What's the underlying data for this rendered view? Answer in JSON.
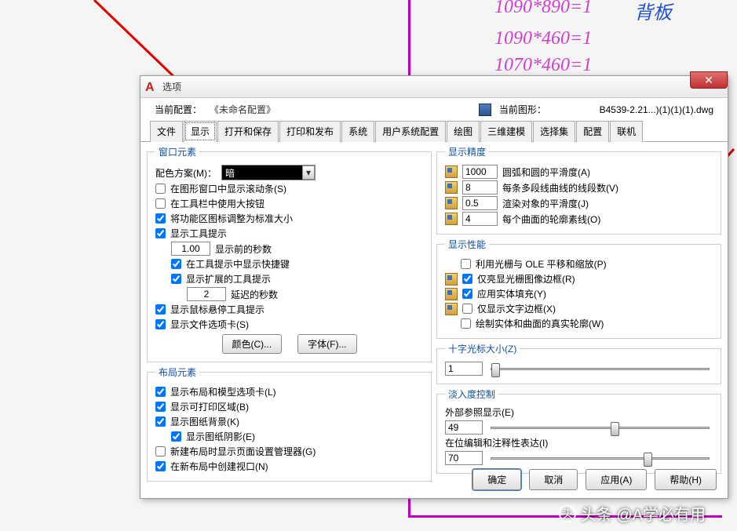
{
  "bg": {
    "line1": "1090*890=1",
    "line1b": "背板",
    "line2": "1090*460=1",
    "line3": "1070*460=1"
  },
  "dialog": {
    "title": "选项",
    "current_profile_label": "当前配置：",
    "profile_name": "《未命名配置》",
    "current_drawing_label": "当前图形：",
    "drawing_name": "B4539-2.21...)(1)(1)(1).dwg"
  },
  "tabs": [
    "文件",
    "显示",
    "打开和保存",
    "打印和发布",
    "系统",
    "用户系统配置",
    "绘图",
    "三维建模",
    "选择集",
    "配置",
    "联机"
  ],
  "active_tab": 1,
  "window_elements": {
    "legend": "窗口元素",
    "color_scheme_label": "配色方案(M)：",
    "color_scheme_value": "暗",
    "scrollbars": "在图形窗口中显示滚动条(S)",
    "large_buttons": "在工具栏中使用大按钮",
    "resize_ribbon": "将功能区图标调整为标准大小",
    "tooltips": "显示工具提示",
    "tooltip_seconds_val": "1.00",
    "tooltip_seconds_label": "显示前的秒数",
    "tooltip_shortcuts": "在工具提示中显示快捷键",
    "ext_tooltips": "显示扩展的工具提示",
    "ext_tooltip_seconds_val": "2",
    "ext_tooltip_seconds_label": "延迟的秒数",
    "hover_tooltips": "显示鼠标悬停工具提示",
    "file_tabs": "显示文件选项卡(S)",
    "colors_btn": "颜色(C)...",
    "fonts_btn": "字体(F)..."
  },
  "layout_elements": {
    "legend": "布局元素",
    "layout_tabs": "显示布局和模型选项卡(L)",
    "printable": "显示可打印区域(B)",
    "paper_bg": "显示图纸背景(K)",
    "paper_shadow": "显示图纸阴影(E)",
    "page_setup_mgr": "新建布局时显示页面设置管理器(G)",
    "create_vp": "在新布局中创建视口(N)"
  },
  "display_resolution": {
    "legend": "显示精度",
    "arc_val": "1000",
    "arc_label": "圆弧和圆的平滑度(A)",
    "seg_val": "8",
    "seg_label": "每条多段线曲线的线段数(V)",
    "render_val": "0.5",
    "render_label": "渲染对象的平滑度(J)",
    "contour_val": "4",
    "contour_label": "每个曲面的轮廓素线(O)"
  },
  "display_performance": {
    "legend": "显示性能",
    "pan_zoom": "利用光栅与 OLE 平移和缩放(P)",
    "highlight_frame": "仅亮显光栅图像边框(R)",
    "solid_fill": "应用实体填充(Y)",
    "text_frame": "仅显示文字边框(X)",
    "silhouettes": "绘制实体和曲面的真实轮廓(W)"
  },
  "crosshair": {
    "legend": "十字光标大小(Z)",
    "value": "1"
  },
  "fade": {
    "legend": "淡入度控制",
    "xref_label": "外部参照显示(E)",
    "xref_val": "49",
    "inplace_label": "在位编辑和注释性表达(I)",
    "inplace_val": "70"
  },
  "footer": {
    "ok": "确定",
    "cancel": "取消",
    "apply": "应用(A)",
    "help": "帮助(H)"
  },
  "watermark": "头条 @A学必有用"
}
